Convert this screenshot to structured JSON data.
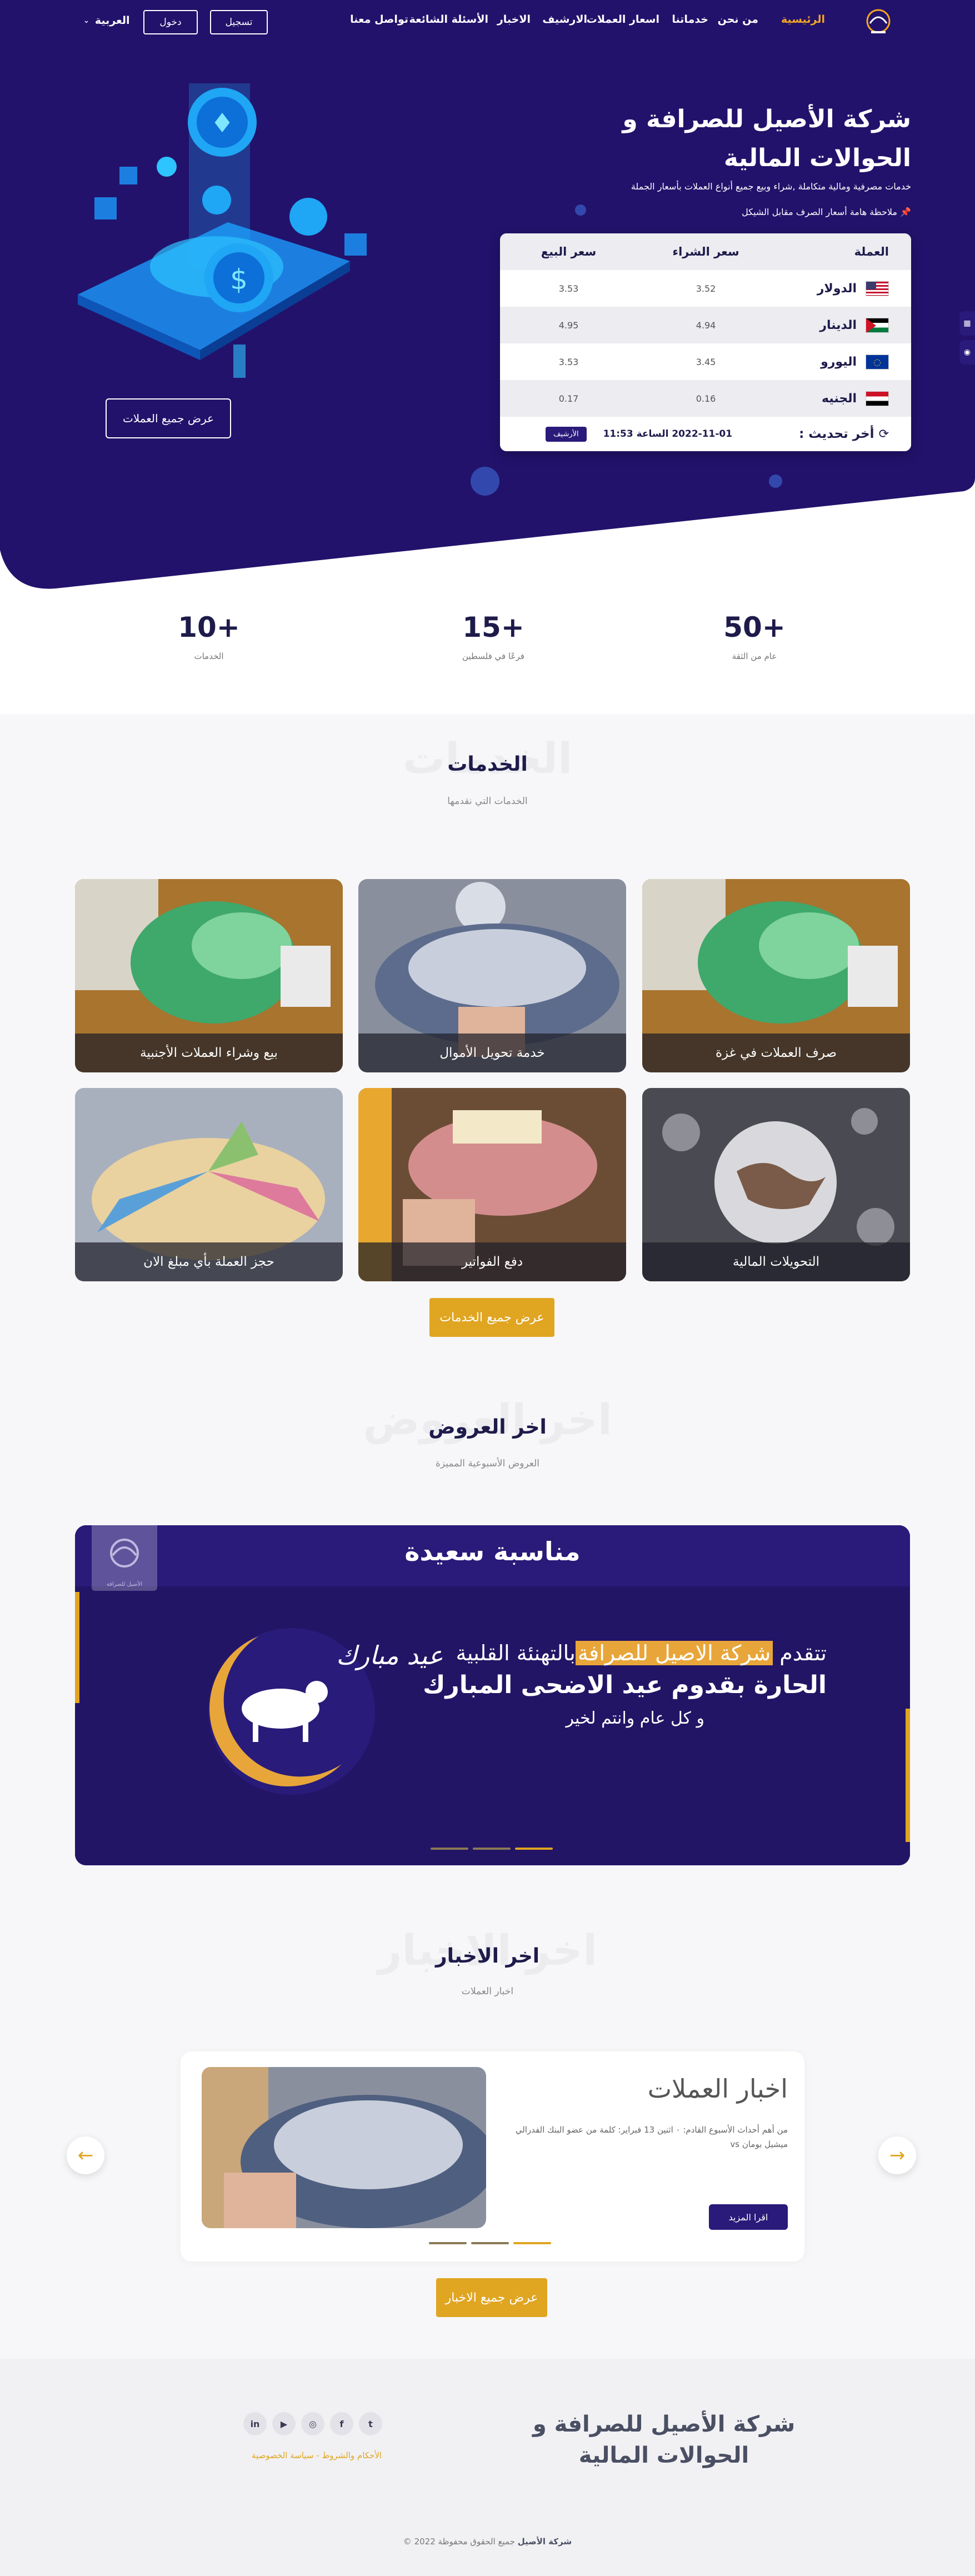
{
  "nav": {
    "links": [
      "الرئيسية",
      "من نحن",
      "خدماتنا",
      "اسعار العملات",
      "الارشيف",
      "الاخبار",
      "الأسئلة الشائعة",
      "تواصل معنا"
    ],
    "register": "تسجيل",
    "login": "دخول",
    "language": "العربية"
  },
  "hero": {
    "title": "شركة الأصيل للصرافة و الحوالات المالية",
    "subtitle": "خدمات مصرفية ومالية متكاملة ,شراء وبيع جميع أنواع العملات بأسعار الجملة",
    "note": "ملاحظة هامة أسعار الصرف مقابل الشيكل",
    "button": "عرض جميع العملات"
  },
  "rates": {
    "headers": [
      "العملة",
      "سعر الشراء",
      "سعر البيع"
    ],
    "rows": [
      {
        "currency": "الدولار",
        "flag": "us-flag",
        "buy": "3.52",
        "sell": "3.53"
      },
      {
        "currency": "الدينار",
        "flag": "jo-flag",
        "buy": "4.94",
        "sell": "4.95"
      },
      {
        "currency": "اليورو",
        "flag": "eu-flag",
        "buy": "3.45",
        "sell": "3.53"
      },
      {
        "currency": "الجنيه",
        "flag": "eg-flag",
        "buy": "0.16",
        "sell": "0.17"
      }
    ],
    "updated_label": "أخر تحديث :",
    "updated_value": "2022-11-01 الساعة 11:53",
    "archive": "الأرشيف"
  },
  "stats": [
    {
      "value": "50+",
      "label": "عام من الثقة"
    },
    {
      "value": "15+",
      "label": "فرعًا في فلسطين"
    },
    {
      "value": "10+",
      "label": "الخدمات"
    }
  ],
  "services": {
    "ghost": "الخدمات",
    "title": "الخدمات",
    "subtitle": "الخدمات التي نقدمها",
    "cards": [
      "صرف العملات في غزة",
      "خدمة تحويل الأموال",
      "بيع وشراء العملات الأجنبية",
      "التحويلات المالية",
      "دفع الفواتير",
      "حجز العملة بأي مبلغ الان"
    ],
    "button": "عرض جميع الخدمات"
  },
  "offers": {
    "ghost": "اخر العروض",
    "title": "اخر العروض",
    "subtitle": "العروض الأسبوعية المميزة",
    "banner_title": "مناسبة سعيدة",
    "line1_pre": "تتقدم",
    "line1_hl": "شركة الاصيل  للصرافة",
    "line1_post": "بالتهنئة القلبية",
    "line2": "الحارة بقدوم عيد الاضحى المبارك",
    "line3": "و كل عام وانتم لخير",
    "logo_text": "الأصيل للصرافة"
  },
  "news": {
    "ghost": "اخر الاخبار",
    "title": "اخر الاخبار",
    "subtitle": "اخبار العملات",
    "card_title": "اخبار العملات",
    "card_body": "من أهم أحداث الأسبوع القادم: ٠ اثنين 13 فبراير: كلمة من عضو البنك الفدرالي ميشيل بومان vs",
    "more": "اقرا المزيد",
    "button": "عرض جميع الاخبار"
  },
  "footer": {
    "title": "شركة الأصيل للصرافة و الحوالات المالية",
    "links": "الأحكام والشروط - سياسة الخصوصية",
    "copyright_pre": "© 2022",
    "copyright_brand": "شركة الأصيل",
    "copyright_post": "جميع الحقوق محفوظة",
    "social": [
      "in",
      "▶",
      "◎",
      "f",
      "t"
    ]
  },
  "colors": {
    "primary": "#22126b",
    "accent": "#e0a521",
    "nav_active": "#f5a623"
  }
}
